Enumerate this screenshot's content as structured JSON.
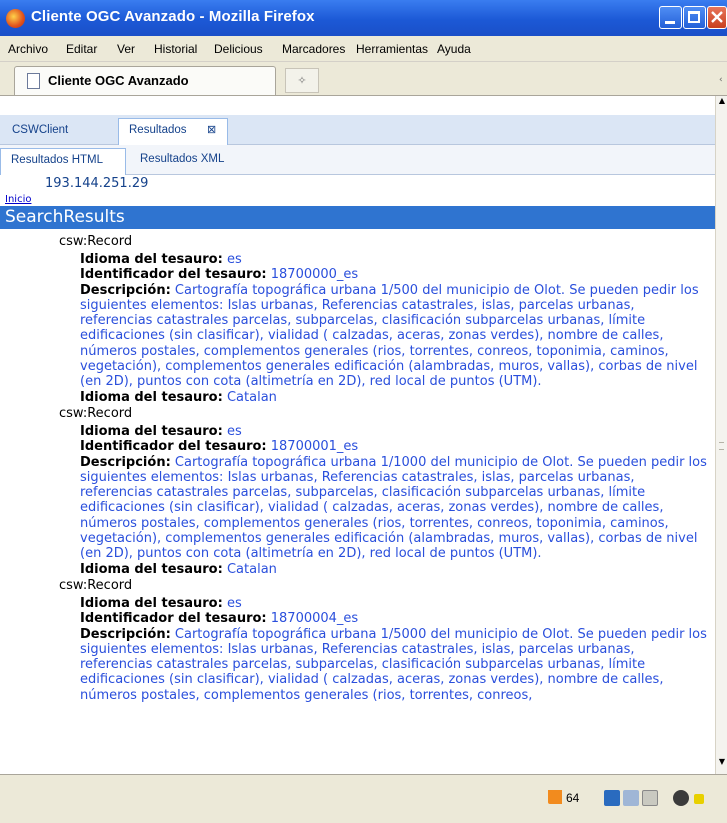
{
  "window": {
    "title": "Cliente OGC Avanzado - Mozilla Firefox"
  },
  "menu": [
    "Archivo",
    "Editar",
    "Ver",
    "Historial",
    "Delicious",
    "Marcadores",
    "Herramientas",
    "Ayuda"
  ],
  "tab": {
    "label": "Cliente OGC Avanzado"
  },
  "app_tabs": {
    "csw_client": "CSWClient",
    "resultados": "Resultados",
    "close_glyph": "⊠"
  },
  "result_tabs": {
    "html": "Resultados HTML",
    "xml": "Resultados XML"
  },
  "server_ip": "193.144.251.29",
  "inicio_link": "Inicio",
  "search_results_title": "SearchResults",
  "labels": {
    "record": "csw:Record",
    "idioma": "Idioma del tesauro:",
    "identificador": "Identificador del tesauro:",
    "descripcion": "Descripción:"
  },
  "records": [
    {
      "idioma": "es",
      "identificador": "18700000_es",
      "descripcion": "Cartografía topográfica urbana 1/500 del municipio de Olot. Se pueden pedir los siguientes elementos: Islas urbanas, Referencias catastrales, islas, parcelas urbanas, referencias catastrales parcelas, subparcelas, clasificación subparcelas urbanas, límite edificaciones (sin clasificar), vialidad ( calzadas, aceras, zonas verdes), nombre de calles, números postales, complementos generales (rios, torrentes, conreos, toponimia, caminos, vegetación), complementos generales edificación (alambradas, muros, vallas), corbas de nivel (en 2D), puntos con cota (altimetría en 2D), red local de puntos (UTM).",
      "idioma2": "Catalan"
    },
    {
      "idioma": "es",
      "identificador": "18700001_es",
      "descripcion": "Cartografía topográfica urbana 1/1000 del municipio de Olot. Se pueden pedir los siguientes elementos: Islas urbanas, Referencias catastrales, islas, parcelas urbanas, referencias catastrales parcelas, subparcelas, clasificación subparcelas urbanas, límite edificaciones (sin clasificar), vialidad ( calzadas, aceras, zonas verdes), nombre de calles, números postales, complementos generales (rios, torrentes, conreos, toponimia, caminos, vegetación), complementos generales edificación (alambradas, muros, vallas), corbas de nivel (en 2D), puntos con cota (altimetría en 2D), red local de puntos (UTM).",
      "idioma2": "Catalan"
    },
    {
      "idioma": "es",
      "identificador": "18700004_es",
      "descripcion": "Cartografía topográfica urbana 1/5000 del municipio de Olot. Se pueden pedir los siguientes elementos: Islas urbanas, Referencias catastrales, islas, parcelas urbanas, referencias catastrales parcelas, subparcelas, clasificación subparcelas urbanas, límite edificaciones (sin clasificar), vialidad ( calzadas, aceras, zonas verdes), nombre de calles, números postales, complementos generales (rios, torrentes, conreos,"
    }
  ],
  "status": {
    "rss_count": "64"
  },
  "colors": {
    "titlebar": "#1c59d6",
    "search_bar": "#2f74d0",
    "value_text": "#2a4fdc"
  }
}
